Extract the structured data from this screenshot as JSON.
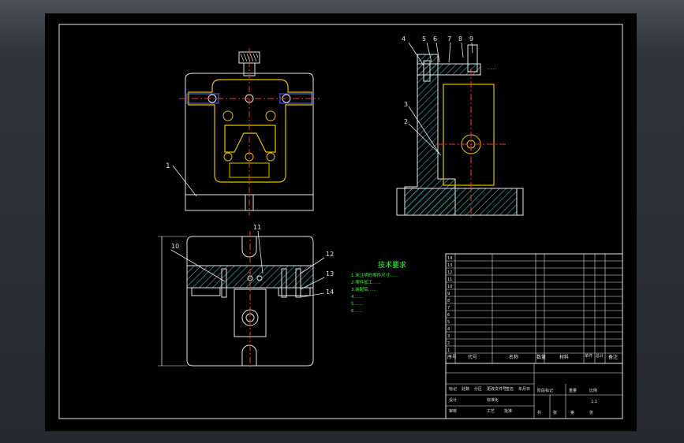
{
  "colors": {
    "background": "#000000",
    "outline": "#ffffff",
    "part": "#e6c200",
    "center_line": "#ff3030",
    "hatch": "#3fbcbc",
    "blue": "#5a6cff",
    "notes": "#3cff3c"
  },
  "front_view": {
    "leader_label": "1"
  },
  "side_view": {
    "leader_labels": [
      "4",
      "5",
      "6",
      "7",
      "8",
      "9",
      "3",
      "2"
    ]
  },
  "top_view": {
    "leader_labels": [
      "11",
      "10",
      "12",
      "13",
      "14"
    ]
  },
  "tech_requirements": {
    "title": "技术要求",
    "lines": [
      "1.未注明的零件尺寸......",
      "2.零件加工......",
      "3.装配后......",
      "4.......",
      "5.......",
      "6......."
    ]
  },
  "bom": {
    "header": {
      "seq": "序号",
      "code": "代号",
      "name": "名称",
      "qty": "数量",
      "material": "材料",
      "unit_weight": "单件",
      "total_weight": "总计",
      "weight_label": "重量",
      "remark": "备注"
    },
    "rows": [
      {
        "seq": "14",
        "code": "",
        "name": "",
        "qty": "",
        "material": "",
        "remark": ""
      },
      {
        "seq": "13",
        "code": "",
        "name": "",
        "qty": "",
        "material": "",
        "remark": ""
      },
      {
        "seq": "12",
        "code": "",
        "name": "",
        "qty": "",
        "material": "",
        "remark": ""
      },
      {
        "seq": "11",
        "code": "",
        "name": "",
        "qty": "",
        "material": "",
        "remark": ""
      },
      {
        "seq": "10",
        "code": "",
        "name": "",
        "qty": "",
        "material": "",
        "remark": ""
      },
      {
        "seq": "9",
        "code": "",
        "name": "",
        "qty": "",
        "material": "",
        "remark": ""
      },
      {
        "seq": "8",
        "code": "",
        "name": "",
        "qty": "",
        "material": "",
        "remark": ""
      },
      {
        "seq": "7",
        "code": "",
        "name": "",
        "qty": "",
        "material": "",
        "remark": ""
      },
      {
        "seq": "6",
        "code": "",
        "name": "",
        "qty": "",
        "material": "",
        "remark": ""
      },
      {
        "seq": "5",
        "code": "",
        "name": "",
        "qty": "",
        "material": "",
        "remark": ""
      },
      {
        "seq": "4",
        "code": "",
        "name": "",
        "qty": "",
        "material": "",
        "remark": ""
      },
      {
        "seq": "3",
        "code": "",
        "name": "",
        "qty": "",
        "material": "",
        "remark": ""
      },
      {
        "seq": "2",
        "code": "",
        "name": "",
        "qty": "",
        "material": "",
        "remark": ""
      },
      {
        "seq": "1",
        "code": "",
        "name": "",
        "qty": "",
        "material": "",
        "remark": ""
      }
    ]
  },
  "title_block": {
    "cells": [
      "标记",
      "处数",
      "分区",
      "更改文件号",
      "签名",
      "年月日",
      "设计",
      "标准化",
      "阶段标记",
      "重量",
      "比例",
      "1:1",
      "审核",
      "工艺",
      "批准",
      "共",
      "张",
      "第",
      "张"
    ]
  }
}
